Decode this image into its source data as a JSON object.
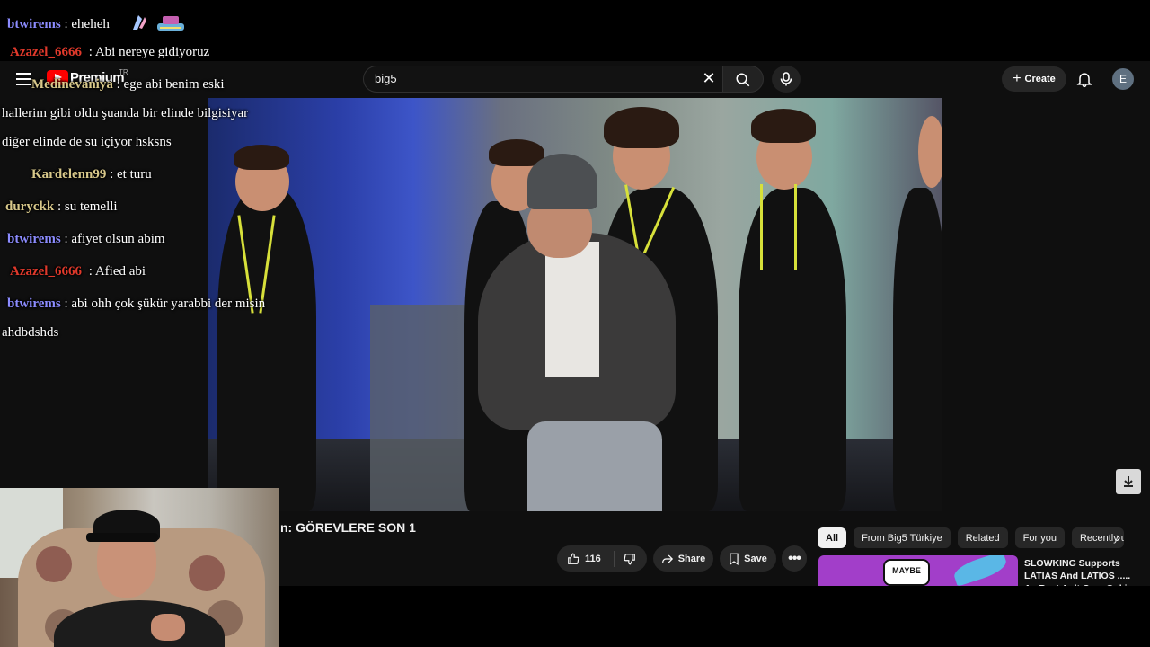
{
  "header": {
    "logo_text": "Premium",
    "logo_region": "TR",
    "search_value": "big5",
    "create_label": "Create",
    "avatar_letter": "E"
  },
  "video": {
    "title": "n: GÖREVLERE SON 1",
    "like_count": "116",
    "share_label": "Share",
    "save_label": "Save",
    "more_label": "•••"
  },
  "chips": [
    "All",
    "From Big5 Türkiye",
    "Related",
    "For you",
    "Recently uploaded"
  ],
  "recommendation": {
    "thumb_text": "MAYBE",
    "title": "SLOWKING Supports LATIAS And LATIOS ..... As Best Ault Com Ooki"
  },
  "chat": [
    {
      "user": "btwirems",
      "user_color": "#8c8cff",
      "text": ": eheheh"
    },
    {
      "user": "Azazel_6666",
      "user_color": "#e0392b",
      "text": ": Abi nereye gidiyoruz"
    },
    {
      "user": "Medinevaniya",
      "user_color": "#d8c88a",
      "text": ": ege abi benim eski"
    },
    {
      "user": "",
      "user_color": "#ffffff",
      "text": "hallerim gibi oldu şuanda bir elinde bilgisiyar"
    },
    {
      "user": "",
      "user_color": "#ffffff",
      "text": "diğer elinde de su içiyor hsksns"
    },
    {
      "user": "Kardelenn99",
      "user_color": "#d8c88a",
      "text": ": et turu"
    },
    {
      "user": "duryckk",
      "user_color": "#d8c88a",
      "text": ": su temelli"
    },
    {
      "user": "btwirems",
      "user_color": "#8c8cff",
      "text": ": afiyet olsun abim"
    },
    {
      "user": "Azazel_6666",
      "user_color": "#e0392b",
      "text": ": Afied abi"
    },
    {
      "user": "btwirems",
      "user_color": "#8c8cff",
      "text": ": abi ohh çok şükür yarabbi der misin"
    },
    {
      "user": "",
      "user_color": "#ffffff",
      "text": "ahdbdshds"
    }
  ],
  "colors": {
    "youtube_red": "#ff0000",
    "page_bg": "#0f0f0f",
    "pill_bg": "#272727"
  }
}
